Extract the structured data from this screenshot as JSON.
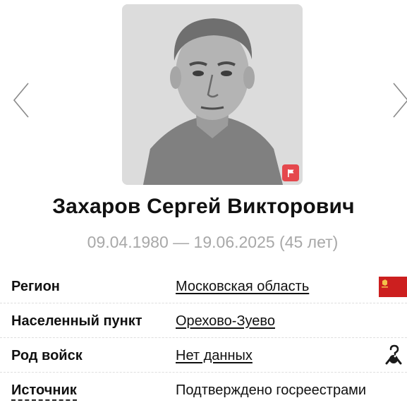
{
  "profile": {
    "name": "Захаров Сергей Викторович",
    "dates": "09.04.1980 — 19.06.2025 (45 лет)"
  },
  "info": {
    "region": {
      "label": "Регион",
      "value": "Московская область"
    },
    "locality": {
      "label": "Населенный пункт",
      "value": "Орехово-Зуево"
    },
    "troops": {
      "label": "Род войск",
      "value": "Нет данных"
    },
    "source": {
      "label": "Источник",
      "value": "Подтверждено госреестрами"
    }
  },
  "icons": {
    "prev": "chevron-left-icon",
    "next": "chevron-right-icon",
    "photo_badge": "flag-icon",
    "region_flag": "moscow-oblast-flag-icon",
    "troops": "unknown-troops-icon"
  },
  "colors": {
    "dates": "#a8a8a8",
    "badge": "#e5484d",
    "region_flag": "#cc1f1f",
    "photo_bg": "#dcdcdc"
  }
}
